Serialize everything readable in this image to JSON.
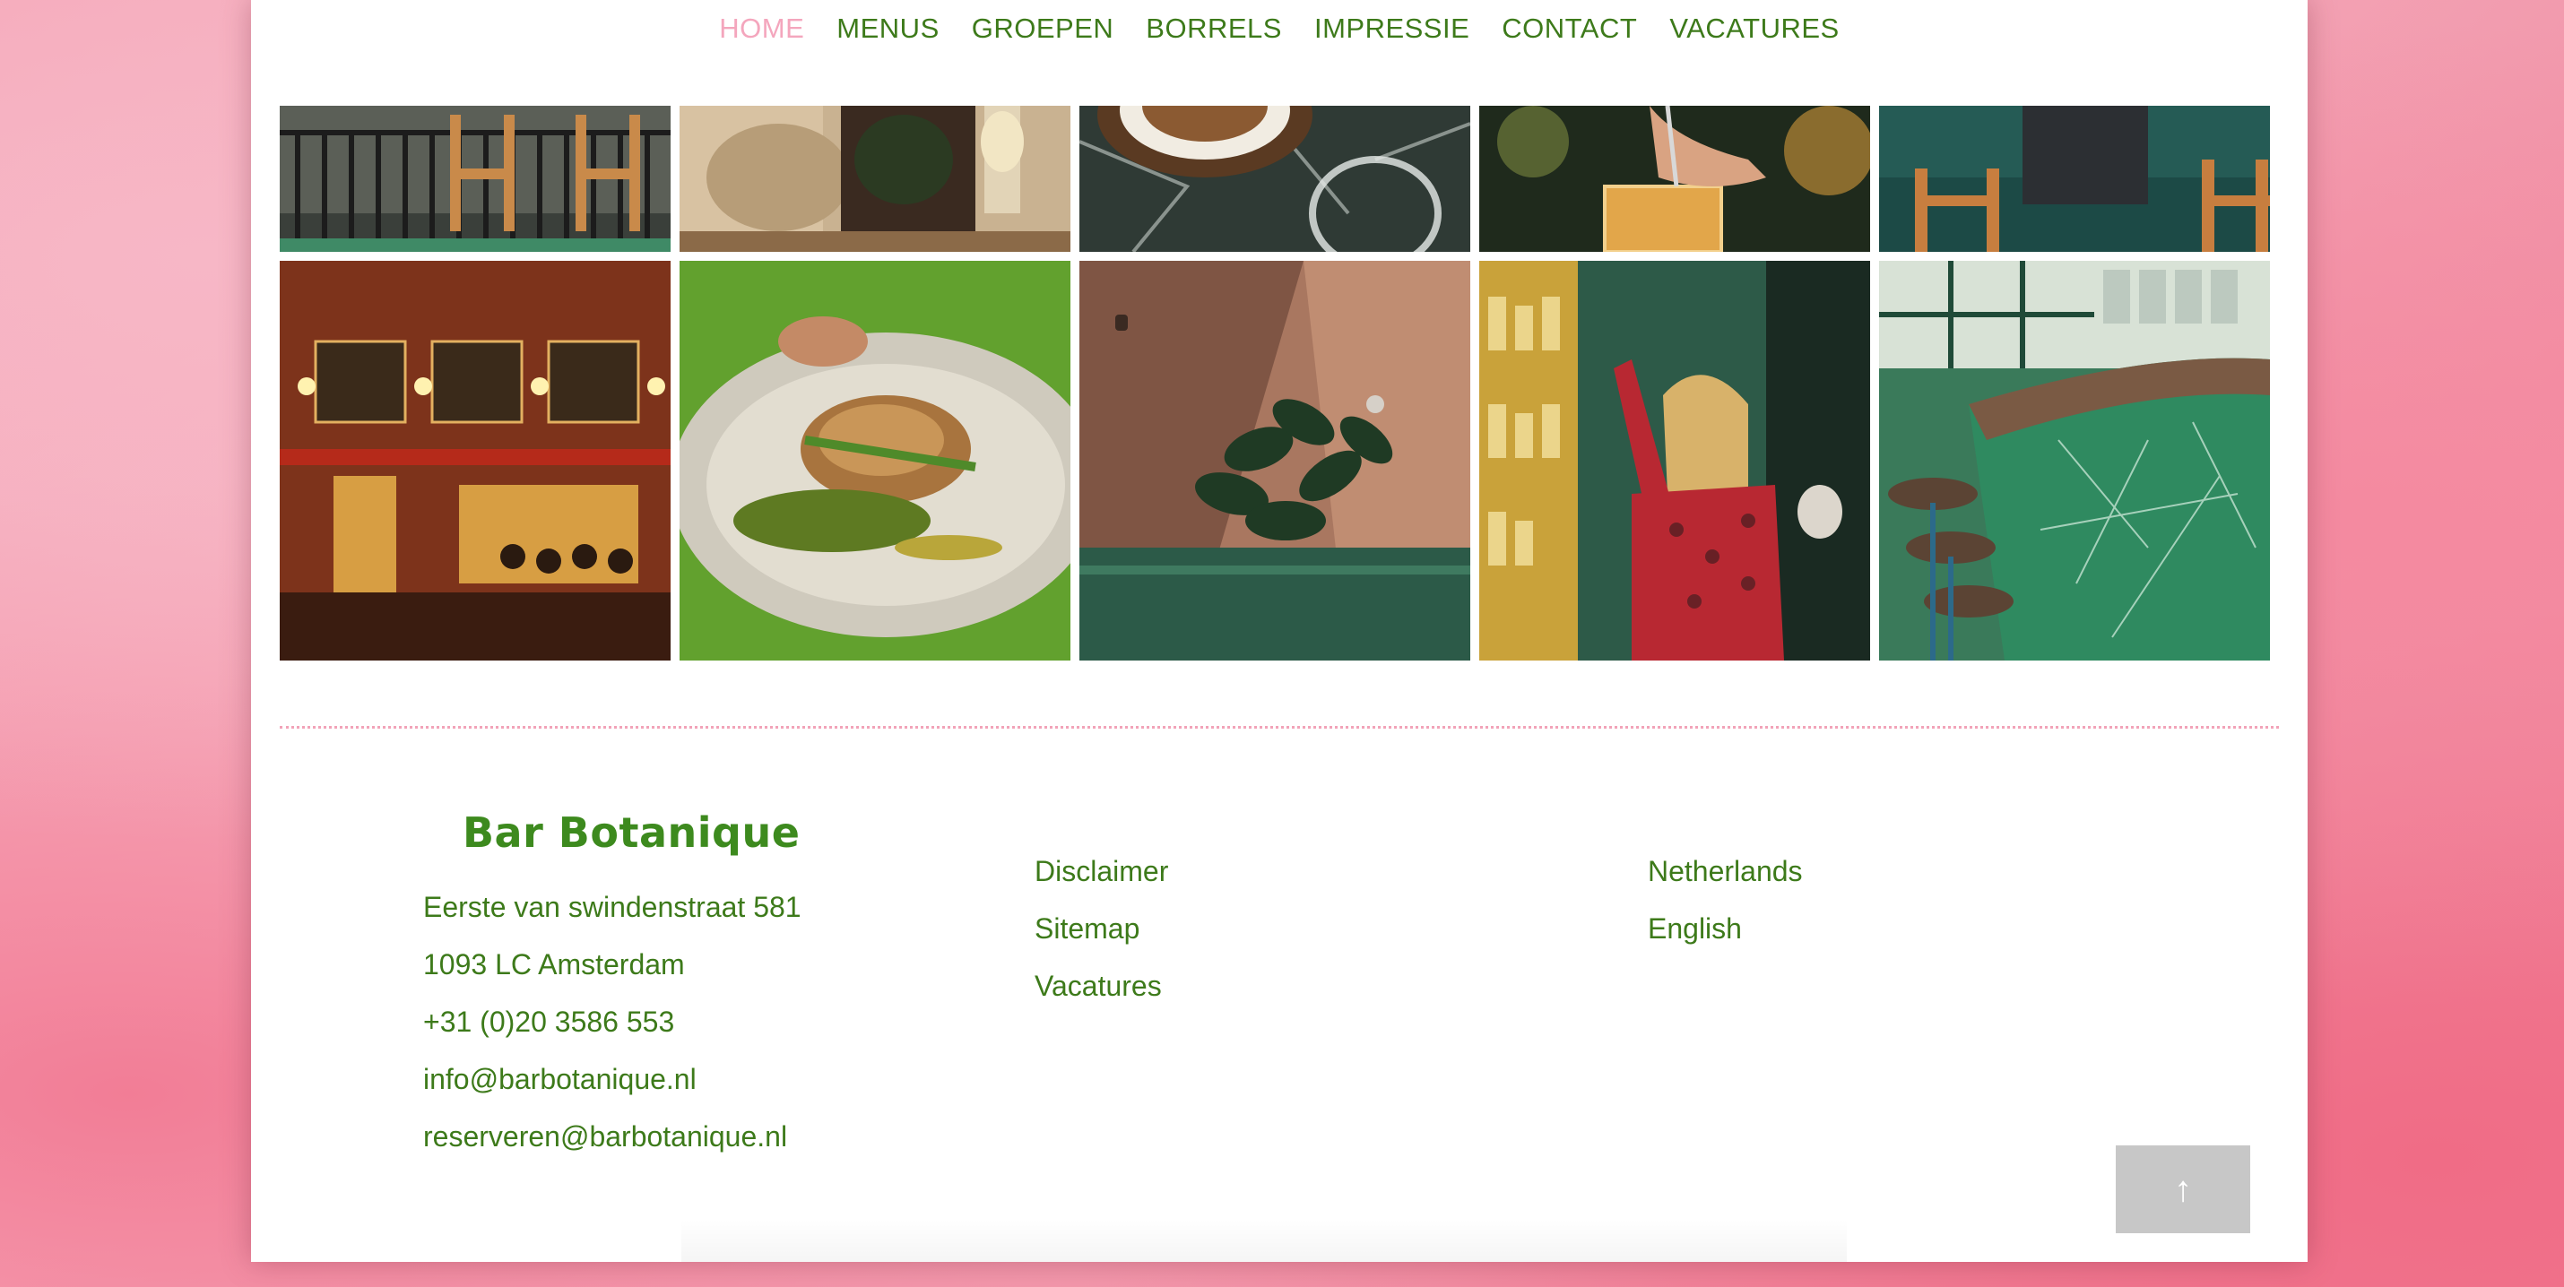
{
  "nav": {
    "items": [
      {
        "label": "HOME",
        "active": true
      },
      {
        "label": "MENUS"
      },
      {
        "label": "GROEPEN"
      },
      {
        "label": "BORRELS"
      },
      {
        "label": "IMPRESSIE"
      },
      {
        "label": "CONTACT"
      },
      {
        "label": "VACATURES"
      }
    ]
  },
  "footer": {
    "brand": "Bar Botanique",
    "address": {
      "street": "Eerste van swindenstraat 581",
      "city": "1093 LC Amsterdam",
      "phone": "+31 (0)20 3586 553",
      "email": "info@barbotanique.nl",
      "reservations": "reserveren@barbotanique.nl"
    },
    "links": [
      "Disclaimer",
      "Sitemap",
      "Vacatures"
    ],
    "languages": [
      "Netherlands",
      "English"
    ]
  },
  "back_to_top": {
    "icon": "arrow-up-icon",
    "glyph": "↑"
  },
  "colors": {
    "brand_green": "#3d8a1e",
    "text_green": "#3d7a1a",
    "active_pink": "#f4a6bd",
    "divider_pink": "#f2a3b8",
    "button_gray": "#c7c7c7"
  }
}
